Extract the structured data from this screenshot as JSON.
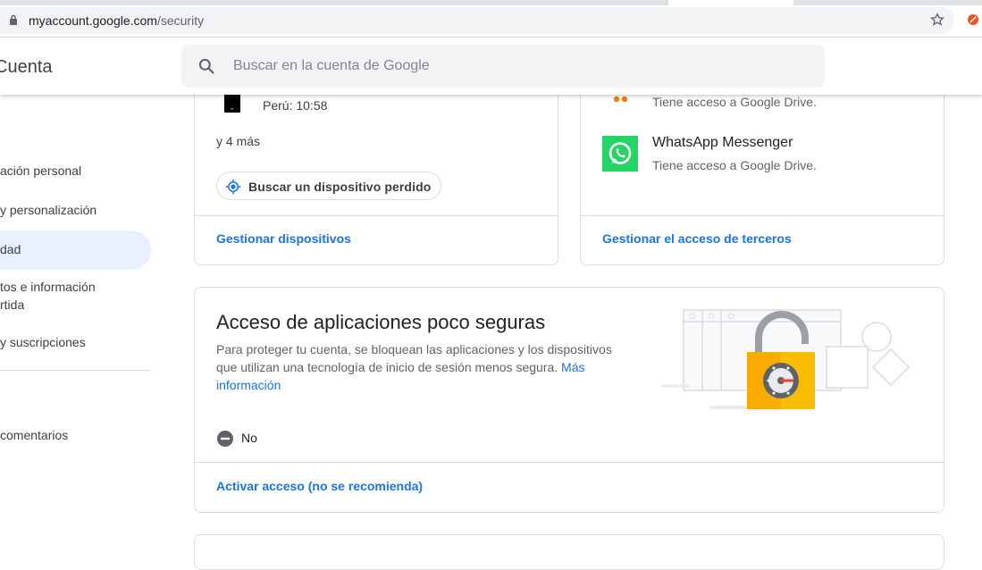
{
  "browser": {
    "url_host": "myaccount.google.com",
    "url_path": "/security"
  },
  "header": {
    "title": "Cuenta",
    "search_placeholder": "Buscar en la cuenta de Google"
  },
  "sidebar": {
    "items": [
      {
        "label": "ación personal"
      },
      {
        "label": "y personalización"
      },
      {
        "label": "dad"
      },
      {
        "label_line1": "tos e información",
        "label_line2": "rtida"
      },
      {
        "label": "y suscripciones"
      },
      {
        "label": "comentarios"
      }
    ]
  },
  "devices_card": {
    "device_location_time": "Perú: 10:58",
    "more_text": "y 4 más",
    "find_device_button": "Buscar un dispositivo perdido",
    "manage_link": "Gestionar dispositivos"
  },
  "third_party_card": {
    "app1_access": "Tiene acceso a Google Drive.",
    "app2_name": "WhatsApp Messenger",
    "app2_access": "Tiene acceso a Google Drive.",
    "manage_link": "Gestionar el acceso de terceros"
  },
  "less_secure_card": {
    "title": "Acceso de aplicaciones poco seguras",
    "description": "Para proteger tu cuenta, se bloquean las aplicaciones y los dispositivos que utilizan una tecnología de inicio de sesión menos segura.",
    "more_info_link": "Más información",
    "status": "No",
    "activate_link": "Activar acceso (no se recomienda)"
  },
  "colors": {
    "accent": "#1a73e8",
    "whatsapp": "#25d366",
    "lock": "#f9ab00"
  }
}
